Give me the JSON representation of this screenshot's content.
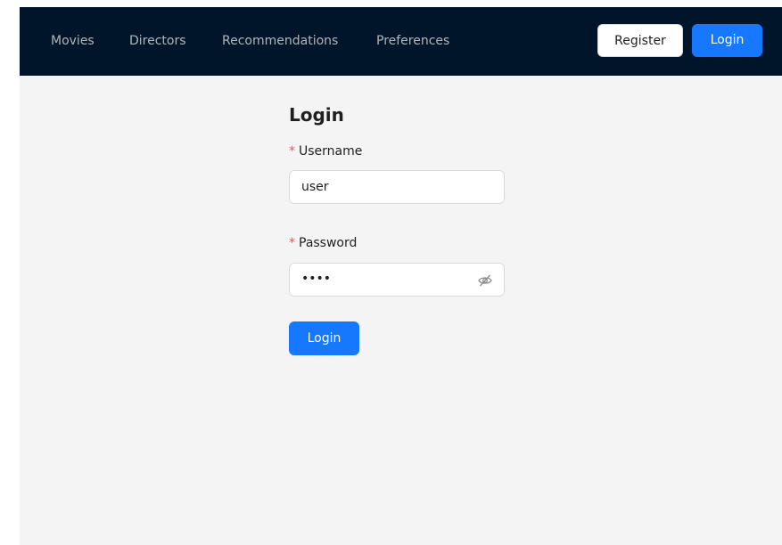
{
  "nav": {
    "items": [
      {
        "label": "Movies"
      },
      {
        "label": "Directors"
      },
      {
        "label": "Recommendations"
      },
      {
        "label": "Preferences"
      }
    ],
    "register_label": "Register",
    "login_label": "Login"
  },
  "form": {
    "title": "Login",
    "required_mark": "*",
    "username": {
      "label": "Username",
      "value": "user"
    },
    "password": {
      "label": "Password",
      "masked_value": "••••",
      "toggle_icon": "eye-invisible-icon"
    },
    "submit_label": "Login"
  },
  "colors": {
    "navbar_bg": "#001529",
    "page_bg": "#f4f4f4",
    "primary": "#1677ff",
    "required": "#ff4d4f"
  }
}
